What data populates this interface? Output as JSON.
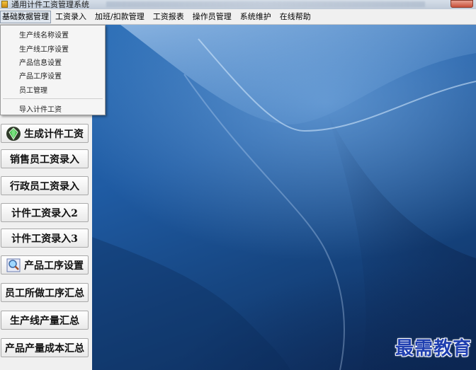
{
  "window": {
    "title": "通用计件工资管理系统"
  },
  "menu": [
    {
      "label": "基础数据管理",
      "active": true
    },
    {
      "label": "工资录入"
    },
    {
      "label": "加班/扣款管理"
    },
    {
      "label": "工资报表"
    },
    {
      "label": "操作员管理"
    },
    {
      "label": "系统维护"
    },
    {
      "label": "在线帮助"
    }
  ],
  "dropdown": {
    "items": [
      "生产线名称设置",
      "生产线工序设置",
      "产品信息设置",
      "产品工序设置",
      "员工管理"
    ],
    "extra_item": "导入计件工资"
  },
  "sidebar": {
    "buttons": [
      {
        "label": "生成计件工资",
        "icon": "gem-icon"
      },
      {
        "label": "销售员工资录入"
      },
      {
        "label": "行政员工资录入"
      },
      {
        "label": "计件工资录入2"
      },
      {
        "label": "计件工资录入3"
      },
      {
        "label": "产品工序设置",
        "icon": "magnifier-icon"
      },
      {
        "label": "员工所做工序汇总"
      },
      {
        "label": "生产线产量汇总"
      },
      {
        "label": "产品产量成本汇总"
      }
    ]
  },
  "watermark": "最需教育",
  "colors": {
    "desktop": "#1f5ba3",
    "watermark": "#1f3fb0",
    "panel": "#f0f0f0"
  }
}
